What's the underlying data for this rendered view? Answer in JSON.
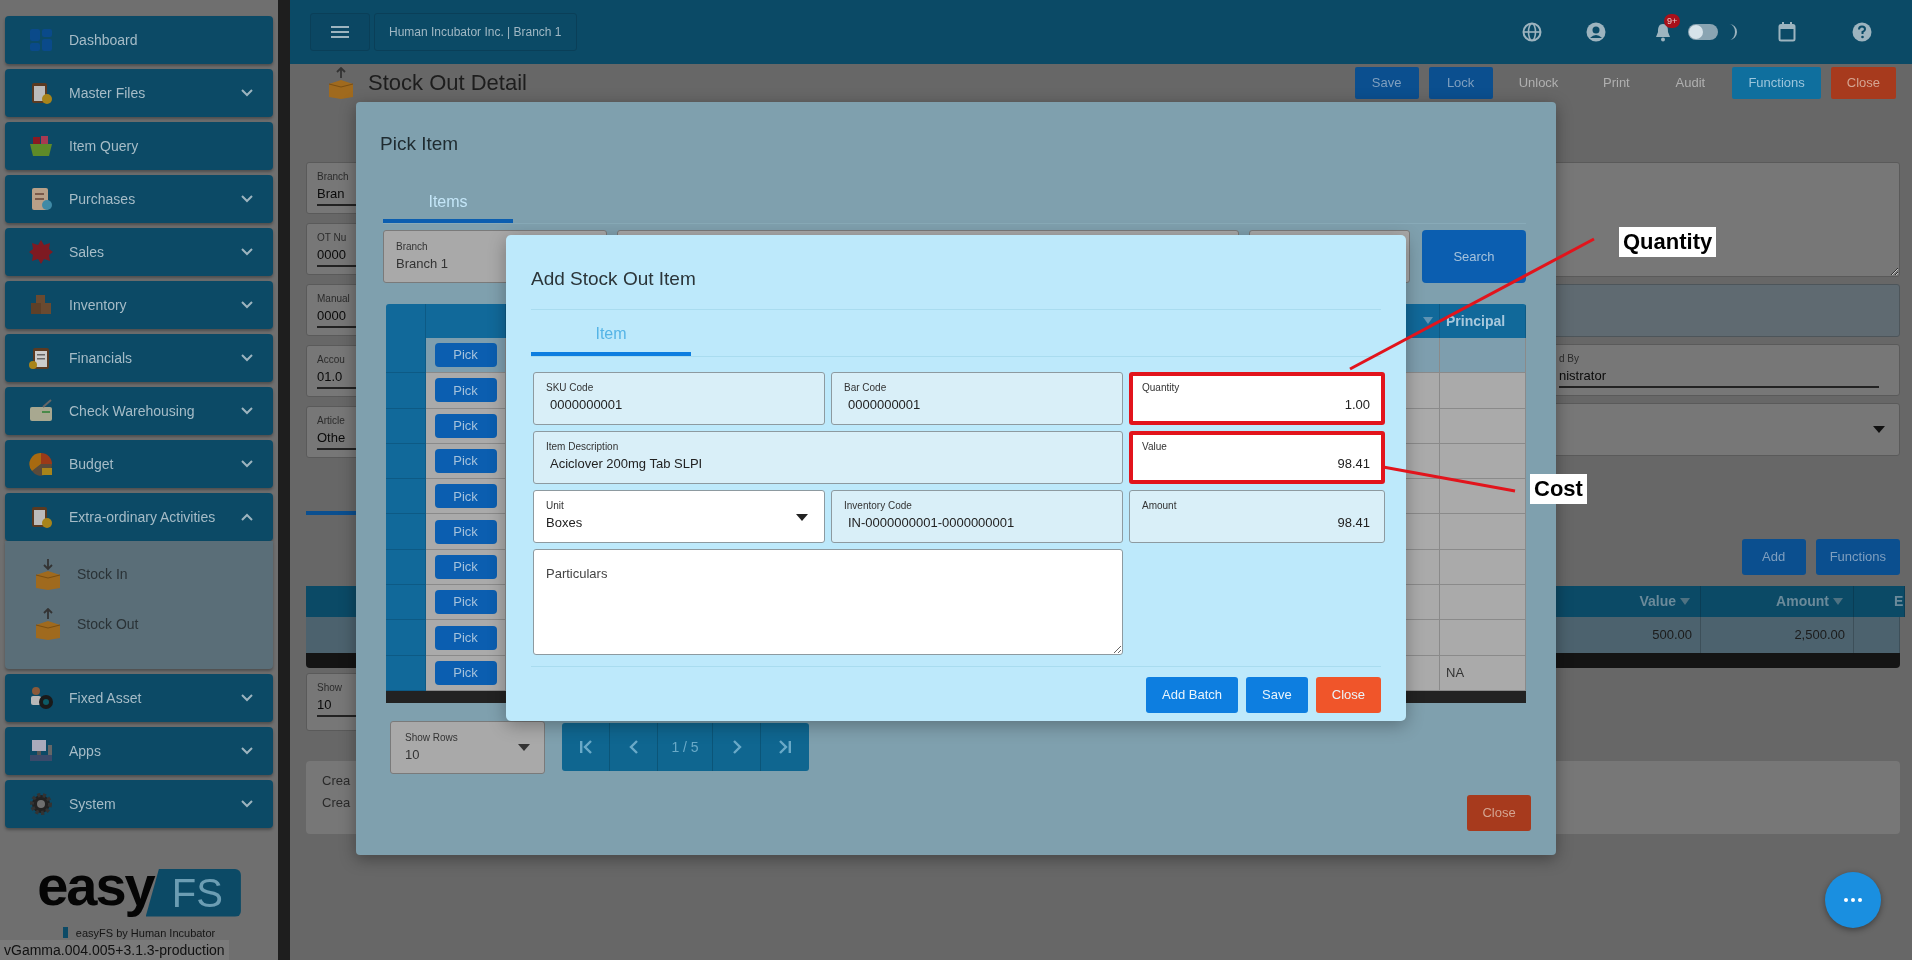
{
  "sidebar": {
    "items": [
      {
        "label": "Dashboard",
        "expandable": false
      },
      {
        "label": "Master Files",
        "expandable": true,
        "expanded": false
      },
      {
        "label": "Item Query",
        "expandable": false
      },
      {
        "label": "Purchases",
        "expandable": true,
        "expanded": false
      },
      {
        "label": "Sales",
        "expandable": true,
        "expanded": false
      },
      {
        "label": "Inventory",
        "expandable": true,
        "expanded": false
      },
      {
        "label": "Financials",
        "expandable": true,
        "expanded": false
      },
      {
        "label": "Check Warehousing",
        "expandable": true,
        "expanded": false
      },
      {
        "label": "Budget",
        "expandable": true,
        "expanded": false
      },
      {
        "label": "Extra-ordinary Activities",
        "expandable": true,
        "expanded": true,
        "children": [
          {
            "label": "Stock In"
          },
          {
            "label": "Stock Out"
          }
        ]
      },
      {
        "label": "Fixed Asset",
        "expandable": true,
        "expanded": false
      },
      {
        "label": "Apps",
        "expandable": true,
        "expanded": false
      },
      {
        "label": "System",
        "expandable": true,
        "expanded": false
      }
    ]
  },
  "logo": {
    "word": "easy",
    "mark": "FS",
    "tagline": "easyFS by Human Incubator"
  },
  "version": "vGamma.004.005+3.1.3-production",
  "topbar": {
    "company": "Human Incubator Inc. | Branch 1",
    "notifications": "9+",
    "dark_mode": false
  },
  "page": {
    "title": "Stock Out Detail",
    "buttons": [
      {
        "label": "Save",
        "kind": "primary"
      },
      {
        "label": "Lock",
        "kind": "primary"
      },
      {
        "label": "Unlock",
        "kind": "plain"
      },
      {
        "label": "Print",
        "kind": "plain"
      },
      {
        "label": "Audit",
        "kind": "plain"
      },
      {
        "label": "Functions",
        "kind": "info"
      },
      {
        "label": "Close",
        "kind": "danger"
      }
    ]
  },
  "form": {
    "left_fields": [
      {
        "label": "Branch",
        "value": "Bran"
      },
      {
        "label": "OT Nu",
        "value": "0000"
      },
      {
        "label": "Manual",
        "value": "0000"
      },
      {
        "label": "Accou",
        "value": "01.0"
      },
      {
        "label": "Article",
        "value": "Othe"
      }
    ],
    "right_fields": [
      {
        "kind": "textarea"
      },
      {
        "kind": "readonly"
      },
      {
        "kind": "text",
        "label": "d By",
        "value": "nistrator"
      },
      {
        "kind": "select"
      }
    ]
  },
  "details": {
    "buttons": [
      "Add",
      "Functions"
    ],
    "table": {
      "columns": [
        "Value",
        "Amount",
        "E"
      ],
      "rows": [
        [
          "500.00",
          "2,500.00"
        ]
      ]
    },
    "show_rows": {
      "label": "Show",
      "value": "10"
    },
    "footer_lines": [
      "Crea",
      "Crea"
    ]
  },
  "pick_modal": {
    "title": "Pick Item",
    "tabs": [
      {
        "label": "Items",
        "selected": true
      }
    ],
    "branch": {
      "label": "Branch",
      "value": "Branch 1"
    },
    "search_button": "Search",
    "table": {
      "columns": [
        {
          "label": "Principal"
        }
      ],
      "rows": [
        {
          "button": "Pick",
          "selected": true
        },
        {
          "button": "Pick",
          "selected": false
        },
        {
          "button": "Pick",
          "selected": false
        },
        {
          "button": "Pick",
          "selected": false
        },
        {
          "button": "Pick",
          "selected": false
        },
        {
          "button": "Pick",
          "selected": false
        },
        {
          "button": "Pick",
          "selected": false
        },
        {
          "button": "Pick",
          "selected": false
        },
        {
          "button": "Pick",
          "selected": false
        },
        {
          "button": "Pick",
          "selected": false,
          "principal": "NA"
        }
      ]
    },
    "show_rows": {
      "label": "Show Rows",
      "value": "10"
    },
    "pager": "1 / 5",
    "close_button": "Close"
  },
  "item_modal": {
    "title": "Add Stock Out Item",
    "tabs": [
      {
        "label": "Item",
        "selected": true
      }
    ],
    "fields": [
      {
        "kind": "text",
        "label": "SKU Code",
        "value": "0000000001",
        "highlighted": false
      },
      {
        "kind": "text",
        "label": "Bar Code",
        "value": "0000000001",
        "highlighted": false
      },
      {
        "kind": "number",
        "label": "Quantity",
        "value": "1.00",
        "highlighted": true
      },
      {
        "kind": "text",
        "label": "Item Description",
        "value": "Aciclover 200mg Tab SLPI",
        "highlighted": false
      },
      {
        "kind": "number",
        "label": "Value",
        "value": "98.41",
        "highlighted": true
      },
      {
        "kind": "select",
        "label": "Unit",
        "value": "Boxes",
        "highlighted": false
      },
      {
        "kind": "text",
        "label": "Inventory Code",
        "value": "IN-0000000001-0000000001",
        "highlighted": false
      },
      {
        "kind": "total",
        "label": "Amount",
        "value": "98.41",
        "highlighted": false
      },
      {
        "kind": "textarea",
        "placeholder": "Particulars",
        "highlighted": false
      }
    ],
    "buttons": [
      {
        "label": "Add Batch",
        "kind": "primary"
      },
      {
        "label": "Save",
        "kind": "primary"
      },
      {
        "label": "Close",
        "kind": "danger"
      }
    ]
  },
  "annotations": [
    {
      "text": "Quantity"
    },
    {
      "text": "Cost"
    }
  ]
}
